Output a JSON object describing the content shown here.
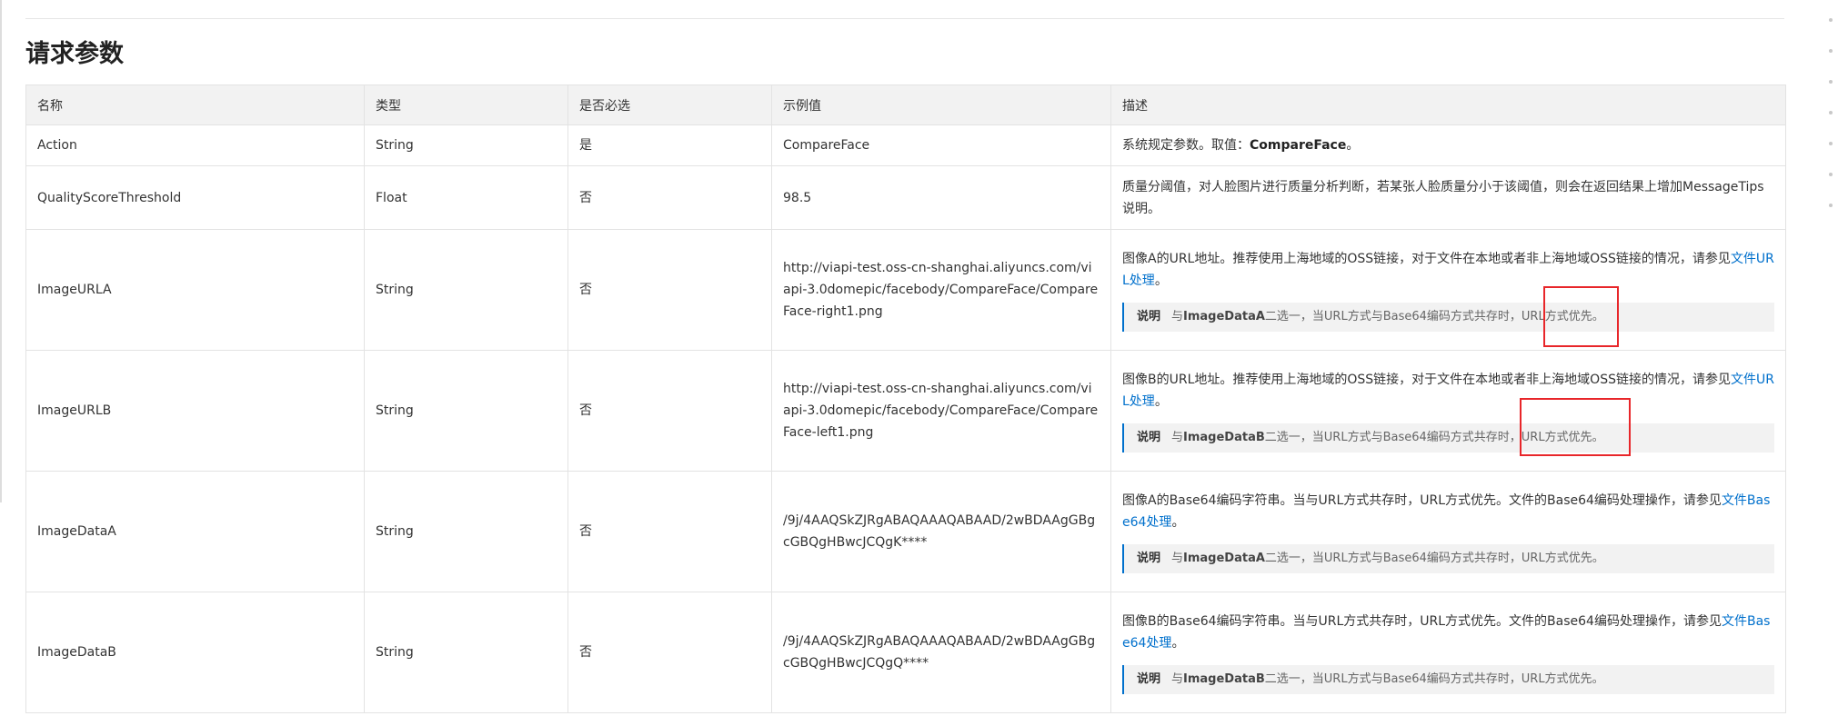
{
  "heading": "请求参数",
  "columns": [
    "名称",
    "类型",
    "是否必选",
    "示例值",
    "描述"
  ],
  "rows": [
    {
      "name": "Action",
      "type": "String",
      "required": "是",
      "example": "CompareFace",
      "desc_prefix": "系统规定参数。取值：",
      "desc_bold": "CompareFace",
      "desc_suffix": "。"
    },
    {
      "name": "QualityScoreThreshold",
      "type": "Float",
      "required": "否",
      "example": "98.5",
      "desc": "质量分阈值，对人脸图片进行质量分析判断，若某张人脸质量分小于该阈值，则会在返回结果上增加MessageTips说明。"
    },
    {
      "name": "ImageURLA",
      "type": "String",
      "required": "否",
      "example": "http://viapi-test.oss-cn-shanghai.aliyuncs.com/viapi-3.0domepic/facebody/CompareFace/CompareFace-right1.png",
      "desc": "图像A的URL地址。推荐使用上海地域的OSS链接，对于文件在本地或者非上海地域OSS链接的情况，请参见",
      "link": "文件URL处理",
      "desc_end": "。",
      "note_label": "说明",
      "note_prefix": "与",
      "note_bold": "ImageDataA",
      "note_suffix": "二选一，当URL方式与Base64编码方式共存时，URL方式优先。"
    },
    {
      "name": "ImageURLB",
      "type": "String",
      "required": "否",
      "example": "http://viapi-test.oss-cn-shanghai.aliyuncs.com/viapi-3.0domepic/facebody/CompareFace/CompareFace-left1.png",
      "desc": "图像B的URL地址。推荐使用上海地域的OSS链接，对于文件在本地或者非上海地域OSS链接的情况，请参见",
      "link": "文件URL处理",
      "desc_end": "。",
      "note_label": "说明",
      "note_prefix": "与",
      "note_bold": "ImageDataB",
      "note_suffix": "二选一，当URL方式与Base64编码方式共存时，URL方式优先。"
    },
    {
      "name": "ImageDataA",
      "type": "String",
      "required": "否",
      "example": "/9j/4AAQSkZJRgABAQAAAQABAAD/2wBDAAgGBgcGBQgHBwcJCQgK****",
      "desc": "图像A的Base64编码字符串。当与URL方式共存时，URL方式优先。文件的Base64编码处理操作，请参见",
      "link": "文件Base64处理",
      "desc_end": "。",
      "note_label": "说明",
      "note_prefix": "与",
      "note_bold": "ImageDataA",
      "note_suffix": "二选一，当URL方式与Base64编码方式共存时，URL方式优先。"
    },
    {
      "name": "ImageDataB",
      "type": "String",
      "required": "否",
      "example": "/9j/4AAQSkZJRgABAQAAAQABAAD/2wBDAAgGBgcGBQgHBwcJCQgQ****",
      "desc": "图像B的Base64编码字符串。当与URL方式共存时，URL方式优先。文件的Base64编码处理操作，请参见",
      "link": "文件Base64处理",
      "desc_end": "。",
      "note_label": "说明",
      "note_prefix": "与",
      "note_bold": "ImageDataB",
      "note_suffix": "二选一，当URL方式与Base64编码方式共存时，URL方式优先。"
    }
  ],
  "colors": {
    "link": "#0070cc",
    "highlight": "#e8262a",
    "header_bg": "#f2f2f2",
    "note_bg": "#f2f2f2"
  }
}
